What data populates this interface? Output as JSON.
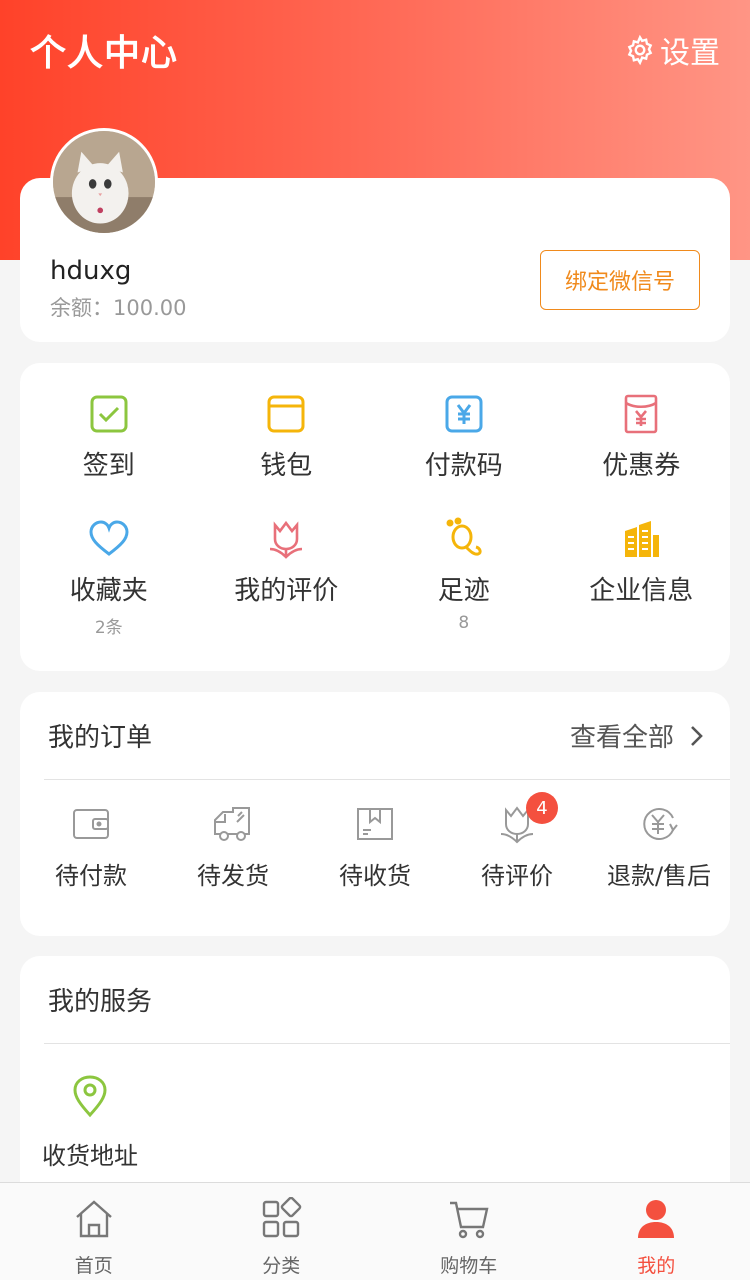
{
  "header": {
    "title": "个人中心",
    "settings_label": "设置"
  },
  "profile": {
    "username": "hduxg",
    "balance": "余额：100.00",
    "bind_button": "绑定微信号"
  },
  "quick_grid": [
    {
      "label": "签到",
      "icon": "checkin-icon",
      "color": "#8cc63f"
    },
    {
      "label": "钱包",
      "icon": "wallet-icon",
      "color": "#f5b50a"
    },
    {
      "label": "付款码",
      "icon": "payment-code-icon",
      "color": "#4aa8e8"
    },
    {
      "label": "优惠券",
      "icon": "coupon-icon",
      "color": "#e8707a"
    },
    {
      "label": "收藏夹",
      "sub": "2条",
      "icon": "heart-icon",
      "color": "#4aa8e8"
    },
    {
      "label": "我的评价",
      "icon": "tulip-icon",
      "color": "#e8707a"
    },
    {
      "label": "足迹",
      "sub": "8",
      "icon": "footprint-icon",
      "color": "#f5b50a"
    },
    {
      "label": "企业信息",
      "icon": "building-icon",
      "color": "#f5b50a"
    }
  ],
  "orders": {
    "title": "我的订单",
    "view_all": "查看全部",
    "items": [
      {
        "label": "待付款",
        "icon": "wallet-outline-icon"
      },
      {
        "label": "待发货",
        "icon": "truck-icon"
      },
      {
        "label": "待收货",
        "icon": "package-icon"
      },
      {
        "label": "待评价",
        "icon": "tulip-outline-icon",
        "badge": "4"
      },
      {
        "label": "退款/售后",
        "icon": "refund-icon"
      }
    ]
  },
  "services": {
    "title": "我的服务",
    "items": [
      {
        "label": "收货地址",
        "icon": "location-pin-icon",
        "color": "#8cc63f"
      }
    ]
  },
  "tabbar": [
    {
      "label": "首页",
      "icon": "home-icon"
    },
    {
      "label": "分类",
      "icon": "category-icon"
    },
    {
      "label": "购物车",
      "icon": "cart-icon"
    },
    {
      "label": "我的",
      "icon": "user-icon",
      "active": true
    }
  ],
  "colors": {
    "header_start": "#ff4229",
    "header_end": "#ff9585",
    "accent": "#f4503f",
    "bind_button": "#f08a1c"
  }
}
